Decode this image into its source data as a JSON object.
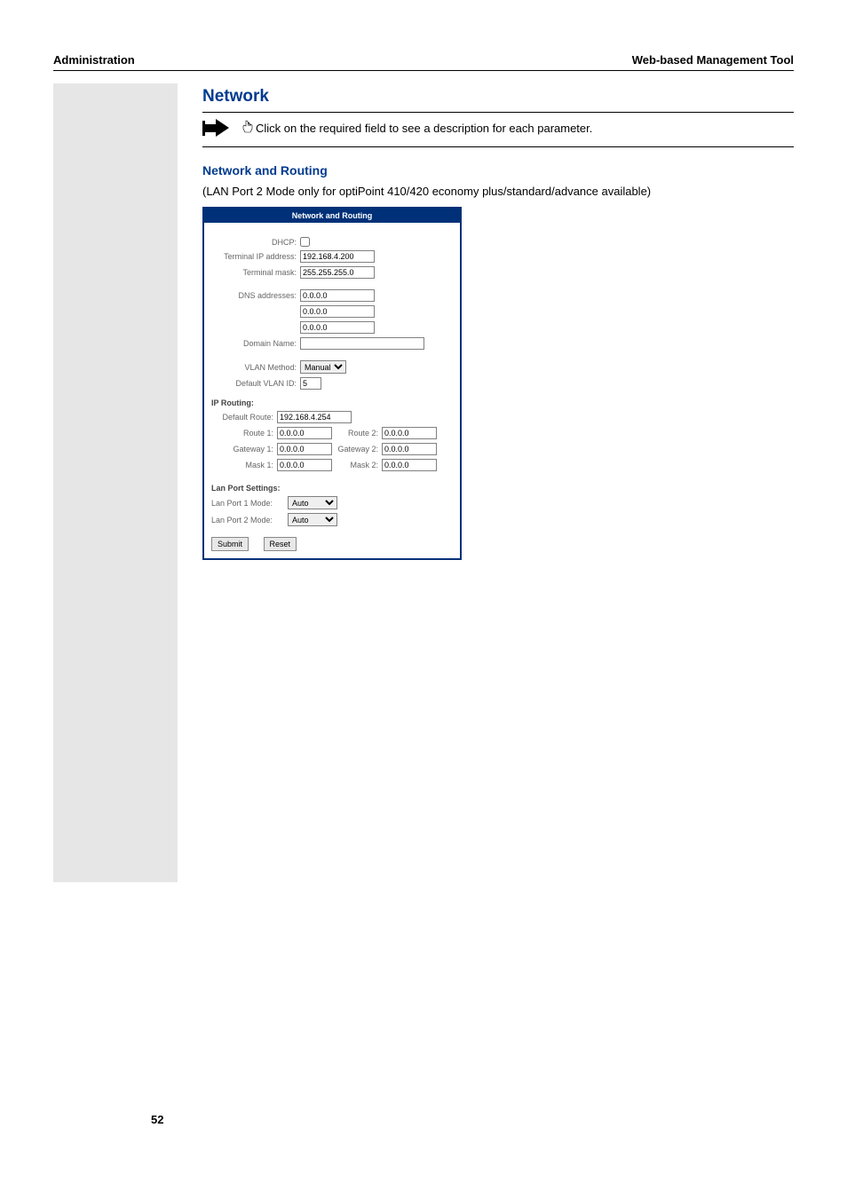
{
  "header": {
    "left": "Administration",
    "right": "Web-based Management Tool"
  },
  "section": {
    "title": "Network",
    "note": "Click on the required field to see a description for each parameter.",
    "sub": "Network and Routing",
    "body": "(LAN Port 2 Mode only for optiPoint 410/420 economy plus/standard/advance available)"
  },
  "form": {
    "title": "Network and Routing",
    "dhcp_label": "DHCP:",
    "terminal_ip_label": "Terminal IP address:",
    "terminal_ip": "192.168.4.200",
    "terminal_mask_label": "Terminal mask:",
    "terminal_mask": "255.255.255.0",
    "dns_label": "DNS addresses:",
    "dns1": "0.0.0.0",
    "dns2": "0.0.0.0",
    "dns3": "0.0.0.0",
    "domain_label": "Domain Name:",
    "domain": "",
    "vlan_method_label": "VLAN Method:",
    "vlan_method": "Manual",
    "vlan_id_label": "Default VLAN ID:",
    "vlan_id": "5",
    "ip_routing": "IP Routing:",
    "default_route_label": "Default Route:",
    "default_route": "192.168.4.254",
    "route1_label": "Route 1:",
    "route1": "0.0.0.0",
    "route2_label": "Route 2:",
    "route2": "0.0.0.0",
    "gateway1_label": "Gateway 1:",
    "gateway1": "0.0.0.0",
    "gateway2_label": "Gateway 2:",
    "gateway2": "0.0.0.0",
    "mask1_label": "Mask 1:",
    "mask1": "0.0.0.0",
    "mask2_label": "Mask 2:",
    "mask2": "0.0.0.0",
    "lan_settings": "Lan Port Settings:",
    "lan1_label": "Lan Port 1 Mode:",
    "lan1": "Auto",
    "lan2_label": "Lan Port 2 Mode:",
    "lan2": "Auto",
    "submit": "Submit",
    "reset": "Reset"
  },
  "page_number": "52"
}
